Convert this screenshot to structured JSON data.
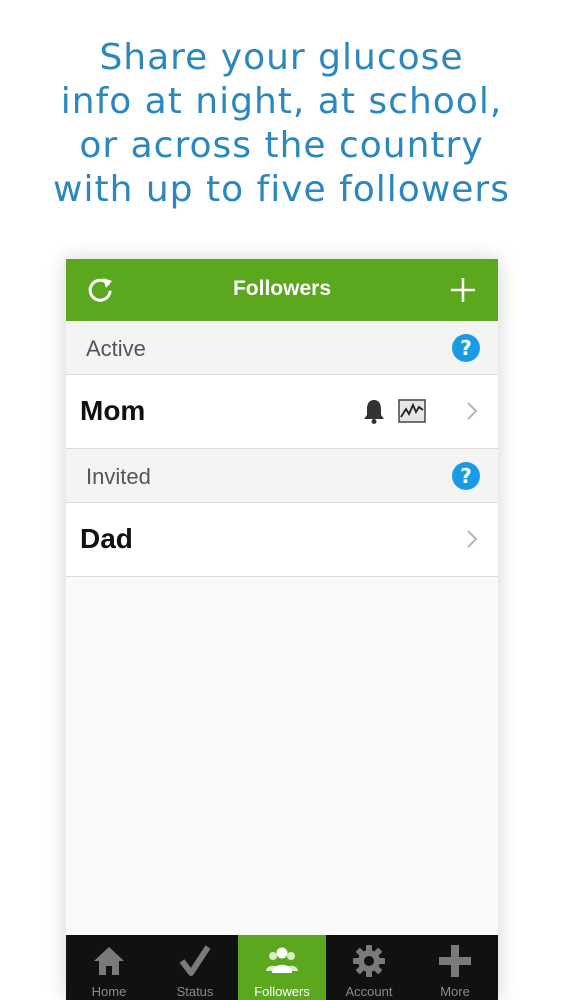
{
  "headline": {
    "line1": "Share your glucose",
    "line2": "info at night, at school,",
    "line3": "or across the country",
    "line4": "with up to five followers"
  },
  "colors": {
    "headline": "#2b87bd",
    "brand_green": "#5ba81e",
    "help_blue": "#1a9be6",
    "tabbar": "#111111"
  },
  "navbar": {
    "title": "Followers",
    "left_icon": "refresh-icon",
    "right_icon": "plus-icon"
  },
  "sections": {
    "active": {
      "label": "Active",
      "help_icon": "?",
      "items": [
        {
          "name": "Mom",
          "icons": [
            "bell-icon",
            "graph-icon"
          ]
        }
      ]
    },
    "invited": {
      "label": "Invited",
      "help_icon": "?",
      "items": [
        {
          "name": "Dad"
        }
      ]
    }
  },
  "tabbar": {
    "tabs": [
      {
        "label": "Home",
        "icon": "home-icon",
        "active": false
      },
      {
        "label": "Status",
        "icon": "checkmark-icon",
        "active": false
      },
      {
        "label": "Followers",
        "icon": "followers-icon",
        "active": true
      },
      {
        "label": "Account",
        "icon": "gear-icon",
        "active": false
      },
      {
        "label": "More",
        "icon": "plus-icon",
        "active": false
      }
    ]
  }
}
